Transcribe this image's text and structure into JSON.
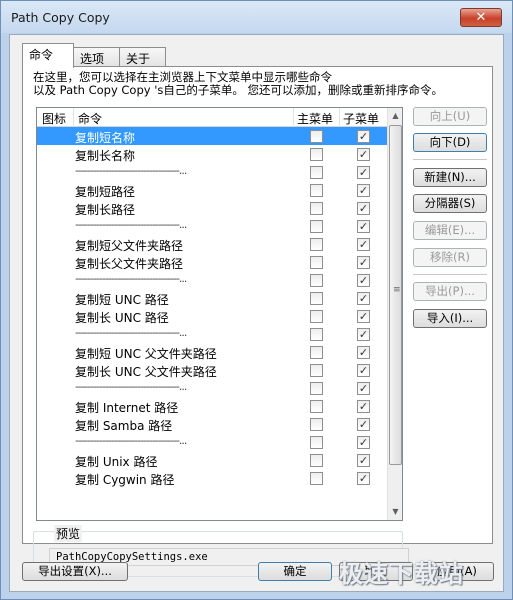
{
  "window": {
    "title": "Path Copy Copy",
    "close_glyph": "✕"
  },
  "tabs": [
    {
      "label": "命令",
      "active": true
    },
    {
      "label": "选项",
      "active": false
    },
    {
      "label": "关于",
      "active": false
    }
  ],
  "description": {
    "line1": "在这里，您可以选择在主浏览器上下文菜单中显示哪些命令",
    "line2": "以及 Path Copy Copy 's自己的子菜单。 您还可以添加，删除或重新排序命令。"
  },
  "list": {
    "columns": {
      "icon": "图标",
      "command": "命令",
      "main_menu": "主菜单",
      "sub_menu": "子菜单"
    },
    "separator_text": "-----------------------------------...",
    "rows": [
      {
        "type": "command",
        "label": "复制短名称",
        "main": false,
        "sub": true,
        "selected": true
      },
      {
        "type": "command",
        "label": "复制长名称",
        "main": false,
        "sub": true
      },
      {
        "type": "separator",
        "main": false,
        "sub": true
      },
      {
        "type": "command",
        "label": "复制短路径",
        "main": false,
        "sub": true
      },
      {
        "type": "command",
        "label": "复制长路径",
        "main": false,
        "sub": true
      },
      {
        "type": "separator",
        "main": false,
        "sub": true
      },
      {
        "type": "command",
        "label": "复制短父文件夹路径",
        "main": false,
        "sub": true
      },
      {
        "type": "command",
        "label": "复制长父文件夹路径",
        "main": false,
        "sub": true
      },
      {
        "type": "separator",
        "main": false,
        "sub": true
      },
      {
        "type": "command",
        "label": "复制短 UNC 路径",
        "main": false,
        "sub": true
      },
      {
        "type": "command",
        "label": "复制长 UNC 路径",
        "main": false,
        "sub": true
      },
      {
        "type": "separator",
        "main": false,
        "sub": true
      },
      {
        "type": "command",
        "label": "复制短 UNC 父文件夹路径",
        "main": false,
        "sub": true
      },
      {
        "type": "command",
        "label": "复制长 UNC 父文件夹路径",
        "main": false,
        "sub": true
      },
      {
        "type": "separator",
        "main": false,
        "sub": true
      },
      {
        "type": "command",
        "label": "复制 Internet 路径",
        "main": false,
        "sub": true
      },
      {
        "type": "command",
        "label": "复制 Samba 路径",
        "main": false,
        "sub": true
      },
      {
        "type": "separator",
        "main": false,
        "sub": true
      },
      {
        "type": "command",
        "label": "复制 Unix 路径",
        "main": false,
        "sub": true
      },
      {
        "type": "command",
        "label": "复制 Cygwin 路径",
        "main": false,
        "sub": true
      }
    ]
  },
  "side_buttons": {
    "move_up": "向上(U)",
    "move_down": "向下(D)",
    "new": "新建(N)...",
    "separator": "分隔器(S)",
    "edit": "编辑(E)...",
    "remove": "移除(R)",
    "export": "导出(P)...",
    "import": "导入(I)..."
  },
  "preview": {
    "label": "预览",
    "value": "PathCopyCopySettings.exe"
  },
  "footer": {
    "export_settings": "导出设置(X)...",
    "ok": "确定",
    "cancel": "取消",
    "apply": "应用(A)"
  },
  "watermark": {
    "text": "极速下载站"
  },
  "icons": {
    "checkbox_check": "✓",
    "scroll_up": "▲",
    "scroll_down": "▼",
    "grip": "≡"
  }
}
